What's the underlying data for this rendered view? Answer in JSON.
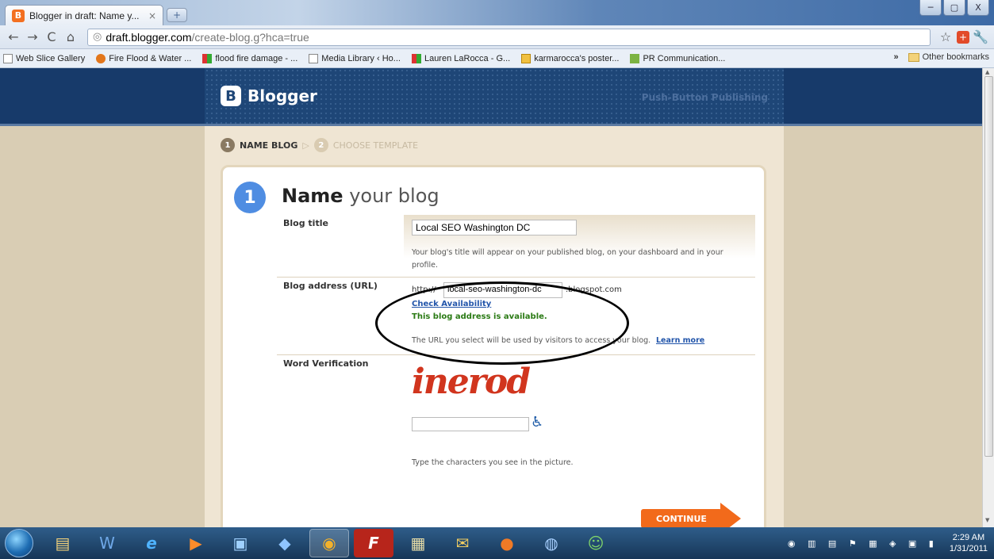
{
  "browser": {
    "tab_title": "Blogger in draft: Name y...",
    "tab_close": "×",
    "new_tab": "+",
    "window_buttons": [
      "─",
      "▢",
      "X"
    ],
    "url_host": "draft.blogger.com",
    "url_path": "/create-blog.g?hca=true",
    "bookmarks": [
      {
        "label": "Web Slice Gallery",
        "icon": "page-icon"
      },
      {
        "label": "Fire Flood & Water ...",
        "icon": "site-icon"
      },
      {
        "label": "flood fire damage - ...",
        "icon": "site-icon"
      },
      {
        "label": "Media Library ‹ Ho...",
        "icon": "page-icon"
      },
      {
        "label": "Lauren LaRocca - G...",
        "icon": "site-icon"
      },
      {
        "label": "karmarocca's poster...",
        "icon": "site-icon"
      },
      {
        "label": "PR Communication...",
        "icon": "site-icon"
      }
    ],
    "bookmarks_overflow": "»",
    "other_bookmarks": "Other bookmarks"
  },
  "header": {
    "logo_letter": "B",
    "logo_text": "Blogger",
    "tagline": "Push-Button Publishing"
  },
  "steps": [
    {
      "num": "1",
      "label": "NAME BLOG"
    },
    {
      "num": "2",
      "label": "CHOOSE TEMPLATE"
    }
  ],
  "card": {
    "num": "1",
    "title_bold": "Name",
    "title_rest": " your blog",
    "blog_title": {
      "label": "Blog title",
      "value": "Local SEO Washington DC",
      "hint": "Your blog's title will appear on your published blog, on your dashboard and in your profile."
    },
    "blog_address": {
      "label": "Blog address (URL)",
      "prefix": "http://",
      "value": "local-seo-washington-dc",
      "suffix": ".blogspot.com",
      "check_link": "Check Availability",
      "available": "This blog address is available.",
      "hint": "The URL you select will be used by visitors to access your blog.",
      "learn_more": "Learn more"
    },
    "word_verification": {
      "label": "Word Verification",
      "captcha": "inerod",
      "value": "",
      "hint": "Type the characters you see in the picture."
    },
    "continue_label": "CONTINUE"
  },
  "taskbar": {
    "time": "2:29 AM",
    "date": "1/31/2011"
  },
  "colors": {
    "header": "#1e4677",
    "accent": "#f26a1b",
    "step_blue": "#4f8de2",
    "available_green": "#2a7a14"
  }
}
